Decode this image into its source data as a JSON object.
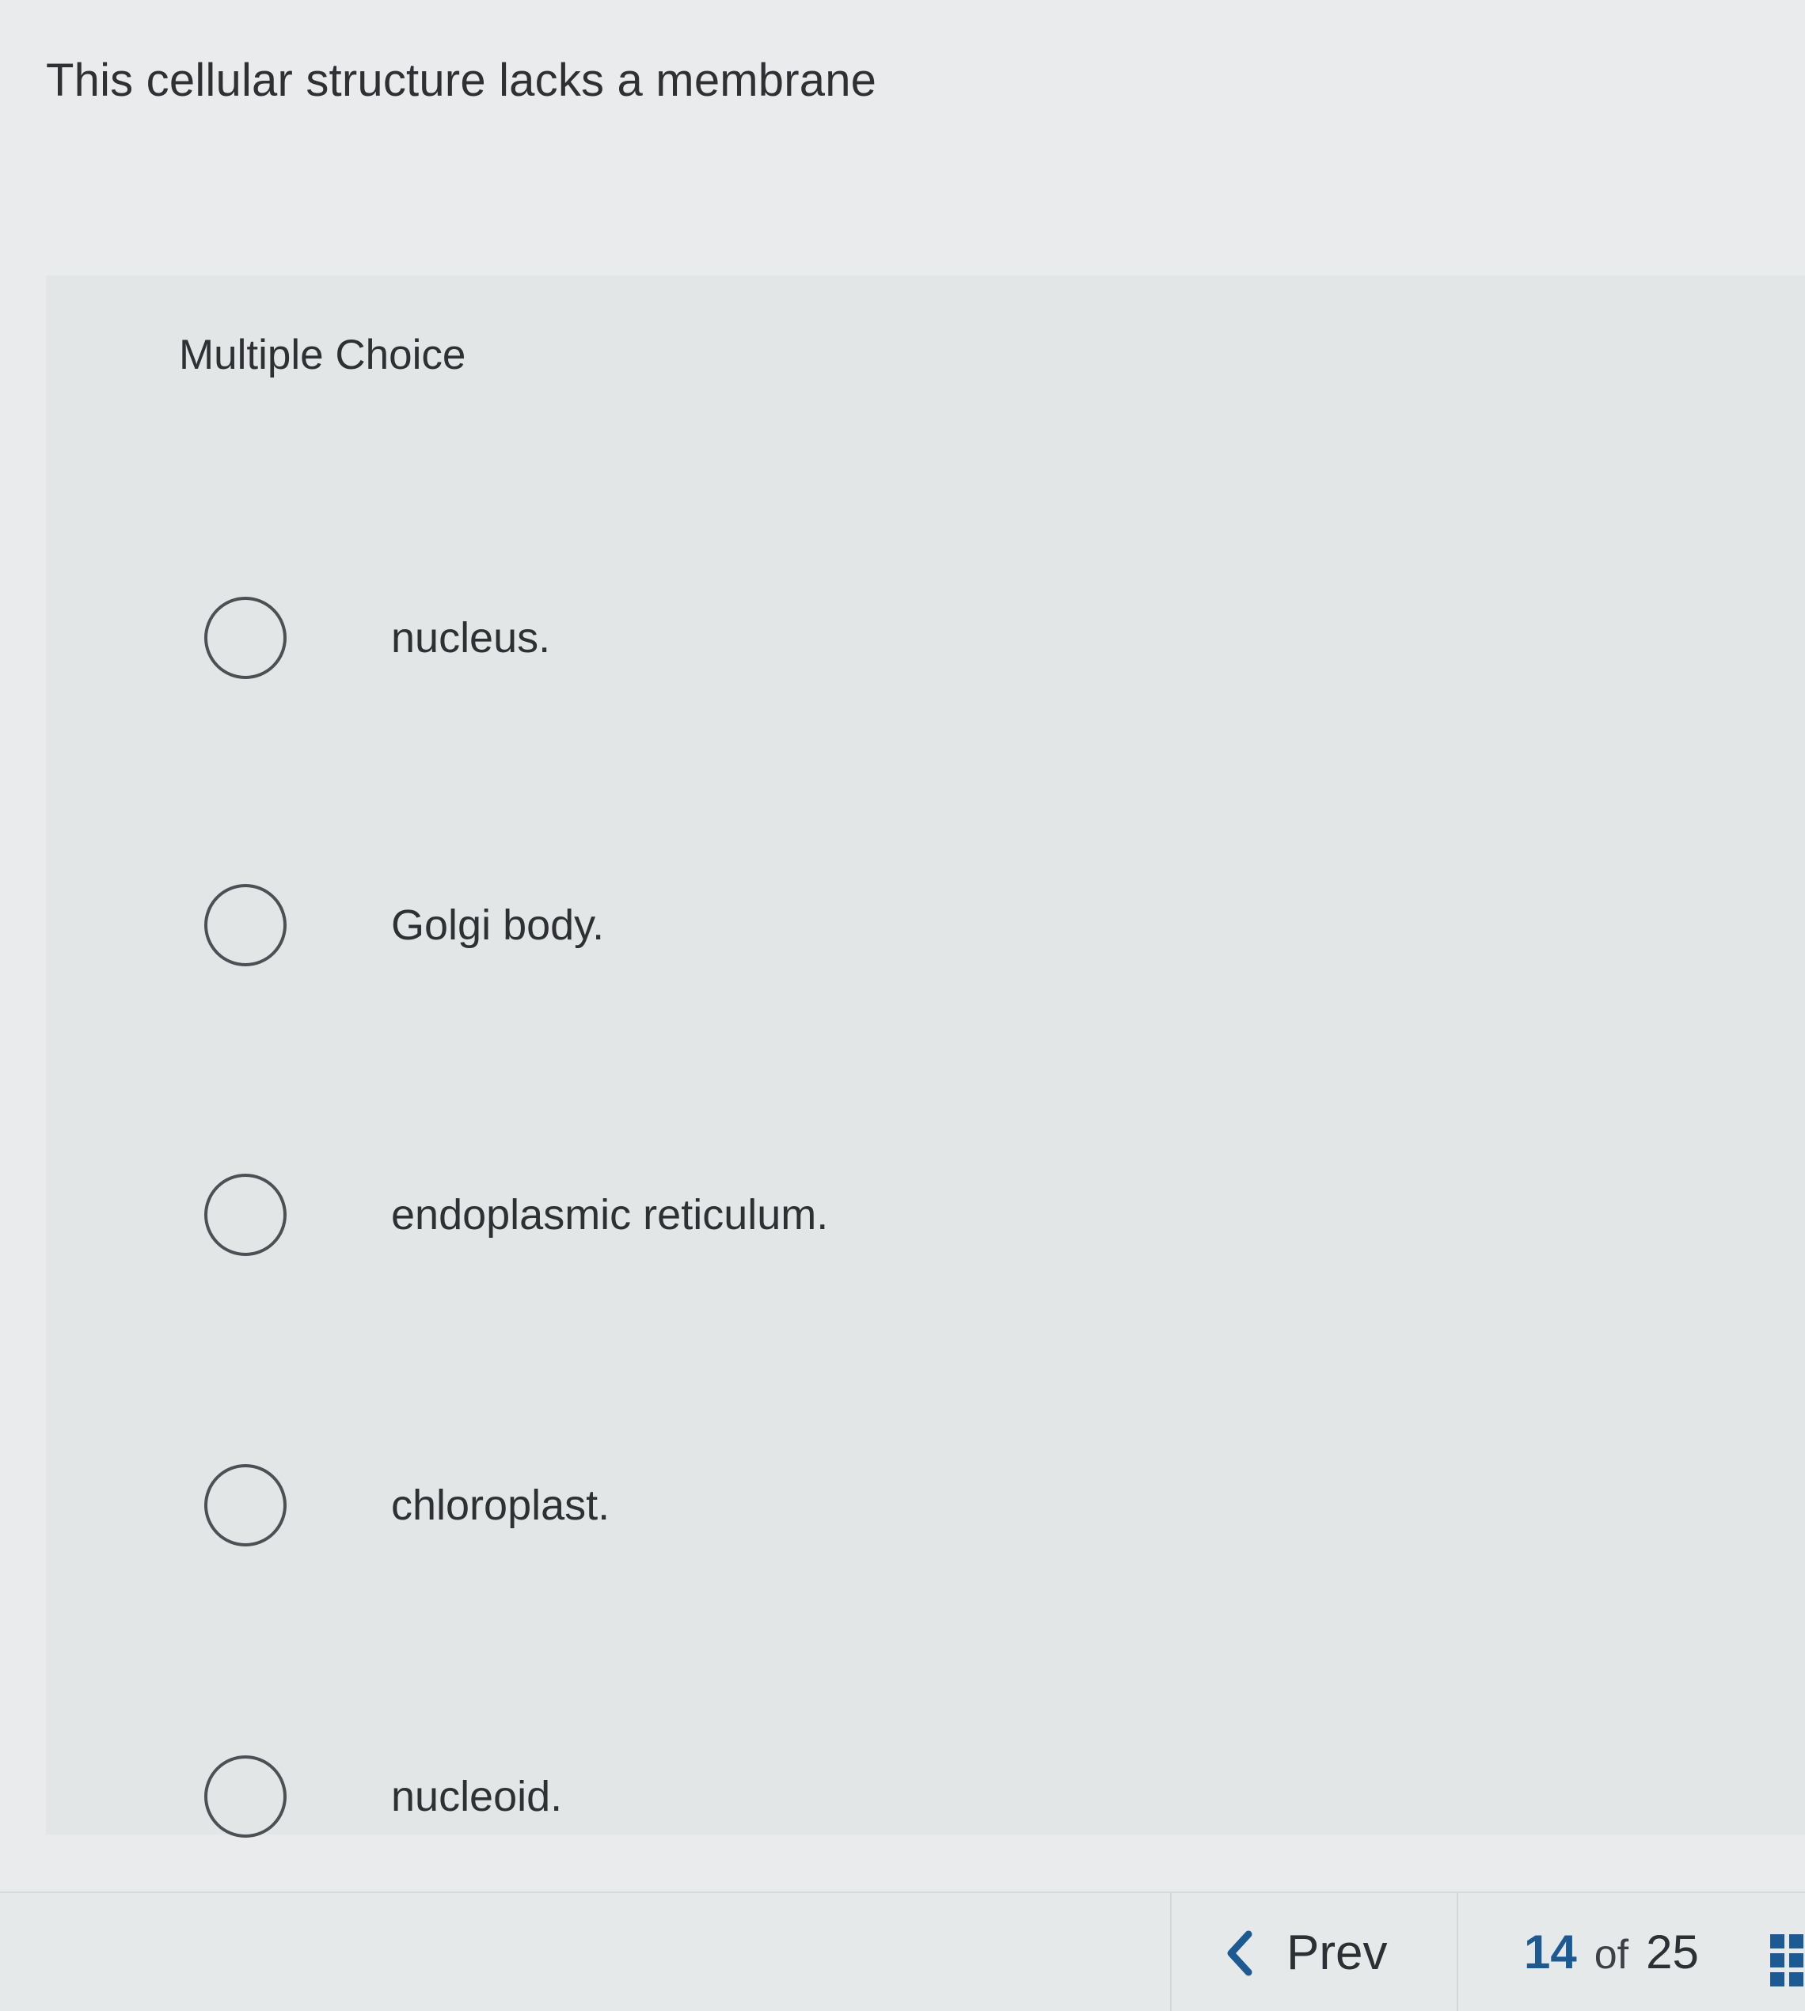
{
  "question": {
    "text": "This cellular structure lacks a membrane"
  },
  "multiple_choice": {
    "label": "Multiple Choice",
    "options": [
      {
        "label": "nucleus."
      },
      {
        "label": "Golgi body."
      },
      {
        "label": "endoplasmic reticulum."
      },
      {
        "label": "chloroplast."
      },
      {
        "label": "nucleoid."
      }
    ]
  },
  "navigation": {
    "prev_label": "Prev",
    "current_page": "14",
    "of_label": "of",
    "total_pages": "25",
    "prev_icon": "chevron-left-icon",
    "grid_icon": "grid-icon"
  },
  "colors": {
    "accent": "#1d5a91",
    "text": "#2e3033",
    "radio_border": "#4c5054"
  }
}
